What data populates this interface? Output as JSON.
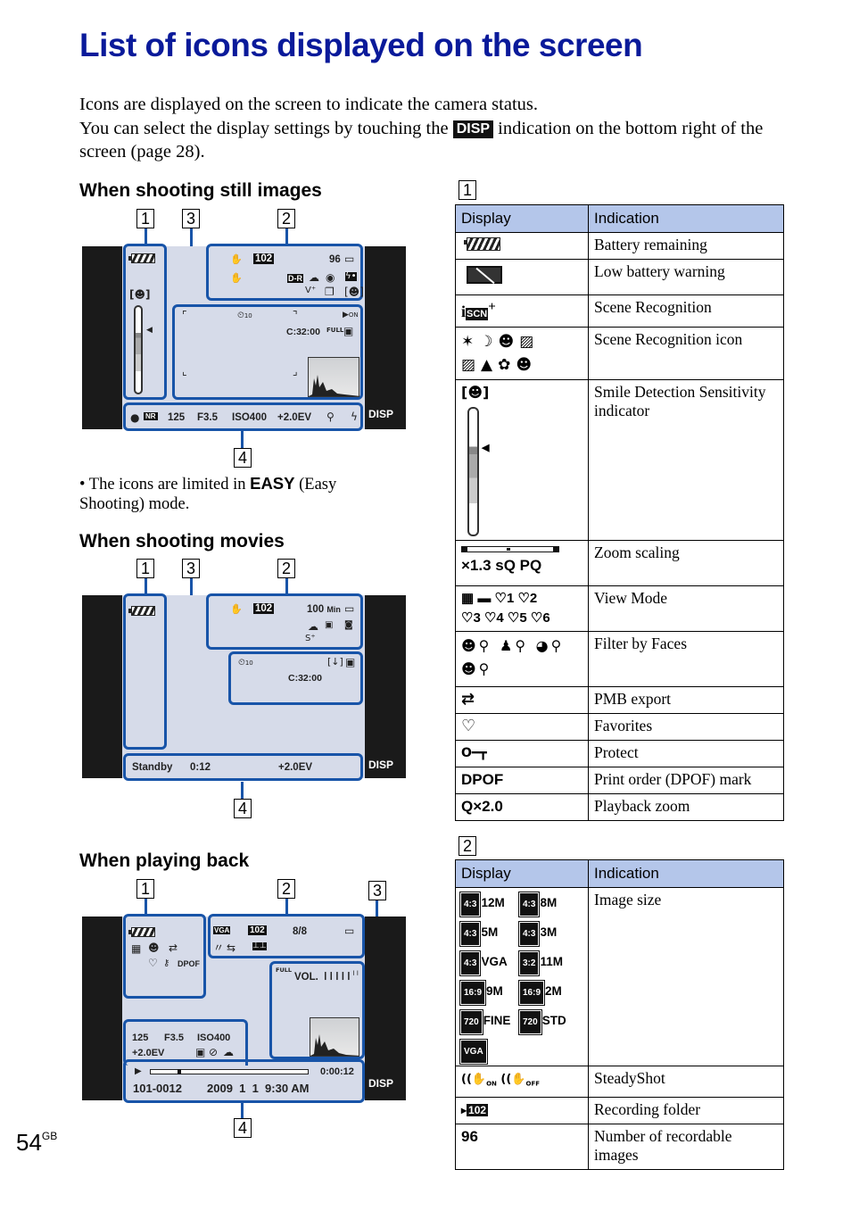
{
  "page": {
    "title": "List of icons displayed on the screen",
    "intro_line1": "Icons are displayed on the screen to indicate the camera status.",
    "intro_line2_pre": "You can select the display settings by touching the",
    "intro_disp": "DISP",
    "intro_line2_post": "indication on the bottom right of the screen (page 28).",
    "page_number": "54",
    "page_suffix": "GB"
  },
  "still": {
    "heading": "When shooting still images",
    "callouts": [
      "1",
      "3",
      "2",
      "4"
    ],
    "zone2": {
      "folder": "102",
      "shots": "96"
    },
    "zone3": {
      "timer": "10",
      "clock": "C:32:00",
      "full": "FULL",
      "on": "ON"
    },
    "zone4": {
      "nr": "NR",
      "shutter": "125",
      "aperture": "F3.5",
      "iso": "ISO400",
      "ev": "+2.0EV"
    },
    "disp": "DISP",
    "note_pre": "The icons are limited in",
    "note_easy": "EASY",
    "note_post": "(Easy Shooting) mode."
  },
  "movie": {
    "heading": "When shooting movies",
    "callouts": [
      "1",
      "3",
      "2",
      "4"
    ],
    "zone2": {
      "folder": "102",
      "remaining": "100",
      "unit": "Min"
    },
    "zone3": {
      "timer": "10",
      "clock": "C:32:00"
    },
    "zone4": {
      "status": "Standby",
      "time": "0:12",
      "ev": "+2.0EV"
    },
    "disp": "DISP"
  },
  "playback": {
    "heading": "When playing back",
    "callouts": [
      "1",
      "2",
      "3",
      "4"
    ],
    "zone1": {
      "dpof": "DPOF"
    },
    "zone2": {
      "size": "VGA",
      "folder": "102",
      "count": "8/8"
    },
    "zone3": {
      "full": "FULL",
      "vol": "VOL."
    },
    "zone4": {
      "shutter": "125",
      "aperture": "F3.5",
      "iso": "ISO400",
      "ev": "+2.0EV",
      "elapsed": "0:00:12",
      "file": "101-0012",
      "date": "2009  1  1  9:30 AM",
      "progress": 0.17
    },
    "disp": "DISP"
  },
  "table1": {
    "label": "1",
    "headers": [
      "Display",
      "Indication"
    ],
    "rows": [
      {
        "display": "battery-icon",
        "indication": "Battery remaining"
      },
      {
        "display": "low-battery-icon",
        "indication": "Low battery warning"
      },
      {
        "display": "iSCN+",
        "indication": "Scene Recognition"
      },
      {
        "display": "scene-icons",
        "indication": "Scene Recognition icon"
      },
      {
        "display": "smile-meter",
        "indication": "Smile Detection Sensitivity indicator"
      },
      {
        "display": "×1.3 sQ PQ",
        "indication": "Zoom scaling"
      },
      {
        "display": "♡1 ♡2 ♡3 ♡4 ♡5 ♡6",
        "indication": "View Mode"
      },
      {
        "display": "face-filters",
        "indication": "Filter by Faces"
      },
      {
        "display": "pmb-icon",
        "indication": "PMB export"
      },
      {
        "display": "♡",
        "indication": "Favorites"
      },
      {
        "display": "key-icon",
        "indication": "Protect"
      },
      {
        "display": "DPOF",
        "indication": "Print order (DPOF) mark"
      },
      {
        "display": "Q×2.0",
        "indication": "Playback zoom"
      }
    ]
  },
  "table2": {
    "label": "2",
    "headers": [
      "Display",
      "Indication"
    ],
    "image_sizes": [
      {
        "ratio": "4:3",
        "size": "12M"
      },
      {
        "ratio": "4:3",
        "size": "8M"
      },
      {
        "ratio": "4:3",
        "size": "5M"
      },
      {
        "ratio": "4:3",
        "size": "3M"
      },
      {
        "ratio": "4:3",
        "size": "VGA"
      },
      {
        "ratio": "3:2",
        "size": "11M"
      },
      {
        "ratio": "16:9",
        "size": "9M"
      },
      {
        "ratio": "16:9",
        "size": "2M"
      },
      {
        "ratio": "720",
        "size": "FINE"
      },
      {
        "ratio": "720",
        "size": "STD"
      },
      {
        "ratio": "VGA",
        "size": ""
      }
    ],
    "rows": [
      {
        "display": "image-size-icons",
        "indication": "Image size"
      },
      {
        "display": "steadyshot-icons",
        "indication": "SteadyShot"
      },
      {
        "display": "102",
        "indication": "Recording folder"
      },
      {
        "display": "96",
        "indication": "Number of recordable images"
      }
    ]
  }
}
